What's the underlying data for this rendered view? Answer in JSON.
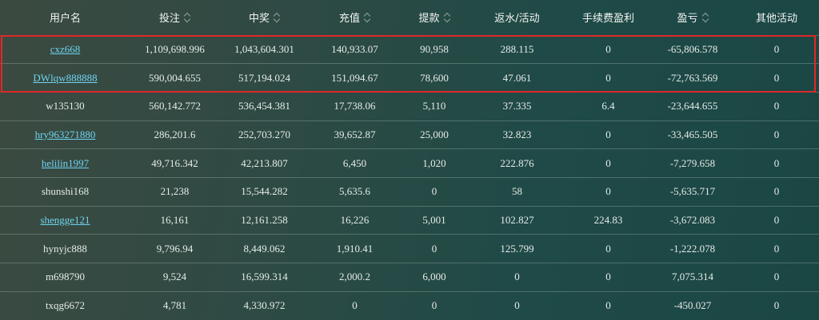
{
  "headers": [
    {
      "label": "用户名",
      "sortable": false
    },
    {
      "label": "投注",
      "sortable": true
    },
    {
      "label": "中奖",
      "sortable": true
    },
    {
      "label": "充值",
      "sortable": true
    },
    {
      "label": "提款",
      "sortable": true
    },
    {
      "label": "返水/活动",
      "sortable": false
    },
    {
      "label": "手续费盈利",
      "sortable": false
    },
    {
      "label": "盈亏",
      "sortable": true
    },
    {
      "label": "其他活动",
      "sortable": false
    }
  ],
  "rows": [
    {
      "user": "cxz668",
      "link": true,
      "cells": [
        "1,109,698.996",
        "1,043,604.301",
        "140,933.07",
        "90,958",
        "288.115",
        "0",
        "-65,806.578",
        "0"
      ]
    },
    {
      "user": "DWlqw888888",
      "link": true,
      "cells": [
        "590,004.655",
        "517,194.024",
        "151,094.67",
        "78,600",
        "47.061",
        "0",
        "-72,763.569",
        "0"
      ]
    },
    {
      "user": "w135130",
      "link": false,
      "cells": [
        "560,142.772",
        "536,454.381",
        "17,738.06",
        "5,110",
        "37.335",
        "6.4",
        "-23,644.655",
        "0"
      ]
    },
    {
      "user": "hry963271880",
      "link": true,
      "cells": [
        "286,201.6",
        "252,703.270",
        "39,652.87",
        "25,000",
        "32.823",
        "0",
        "-33,465.505",
        "0"
      ]
    },
    {
      "user": "helilin1997",
      "link": true,
      "cells": [
        "49,716.342",
        "42,213.807",
        "6,450",
        "1,020",
        "222.876",
        "0",
        "-7,279.658",
        "0"
      ]
    },
    {
      "user": "shunshi168",
      "link": false,
      "cells": [
        "21,238",
        "15,544.282",
        "5,635.6",
        "0",
        "58",
        "0",
        "-5,635.717",
        "0"
      ]
    },
    {
      "user": "shengge121",
      "link": true,
      "cells": [
        "16,161",
        "12,161.258",
        "16,226",
        "5,001",
        "102.827",
        "224.83",
        "-3,672.083",
        "0"
      ]
    },
    {
      "user": "hynyjc888",
      "link": false,
      "cells": [
        "9,796.94",
        "8,449.062",
        "1,910.41",
        "0",
        "125.799",
        "0",
        "-1,222.078",
        "0"
      ]
    },
    {
      "user": "m698790",
      "link": false,
      "cells": [
        "9,524",
        "16,599.314",
        "2,000.2",
        "6,000",
        "0",
        "0",
        "7,075.314",
        "0"
      ]
    },
    {
      "user": "txqg6672",
      "link": false,
      "cells": [
        "4,781",
        "4,330.972",
        "0",
        "0",
        "0",
        "0",
        "-450.027",
        "0"
      ]
    }
  ],
  "colors": {
    "link": "#6fd3f0",
    "highlight": "#e02828",
    "text": "#e6ece8"
  }
}
